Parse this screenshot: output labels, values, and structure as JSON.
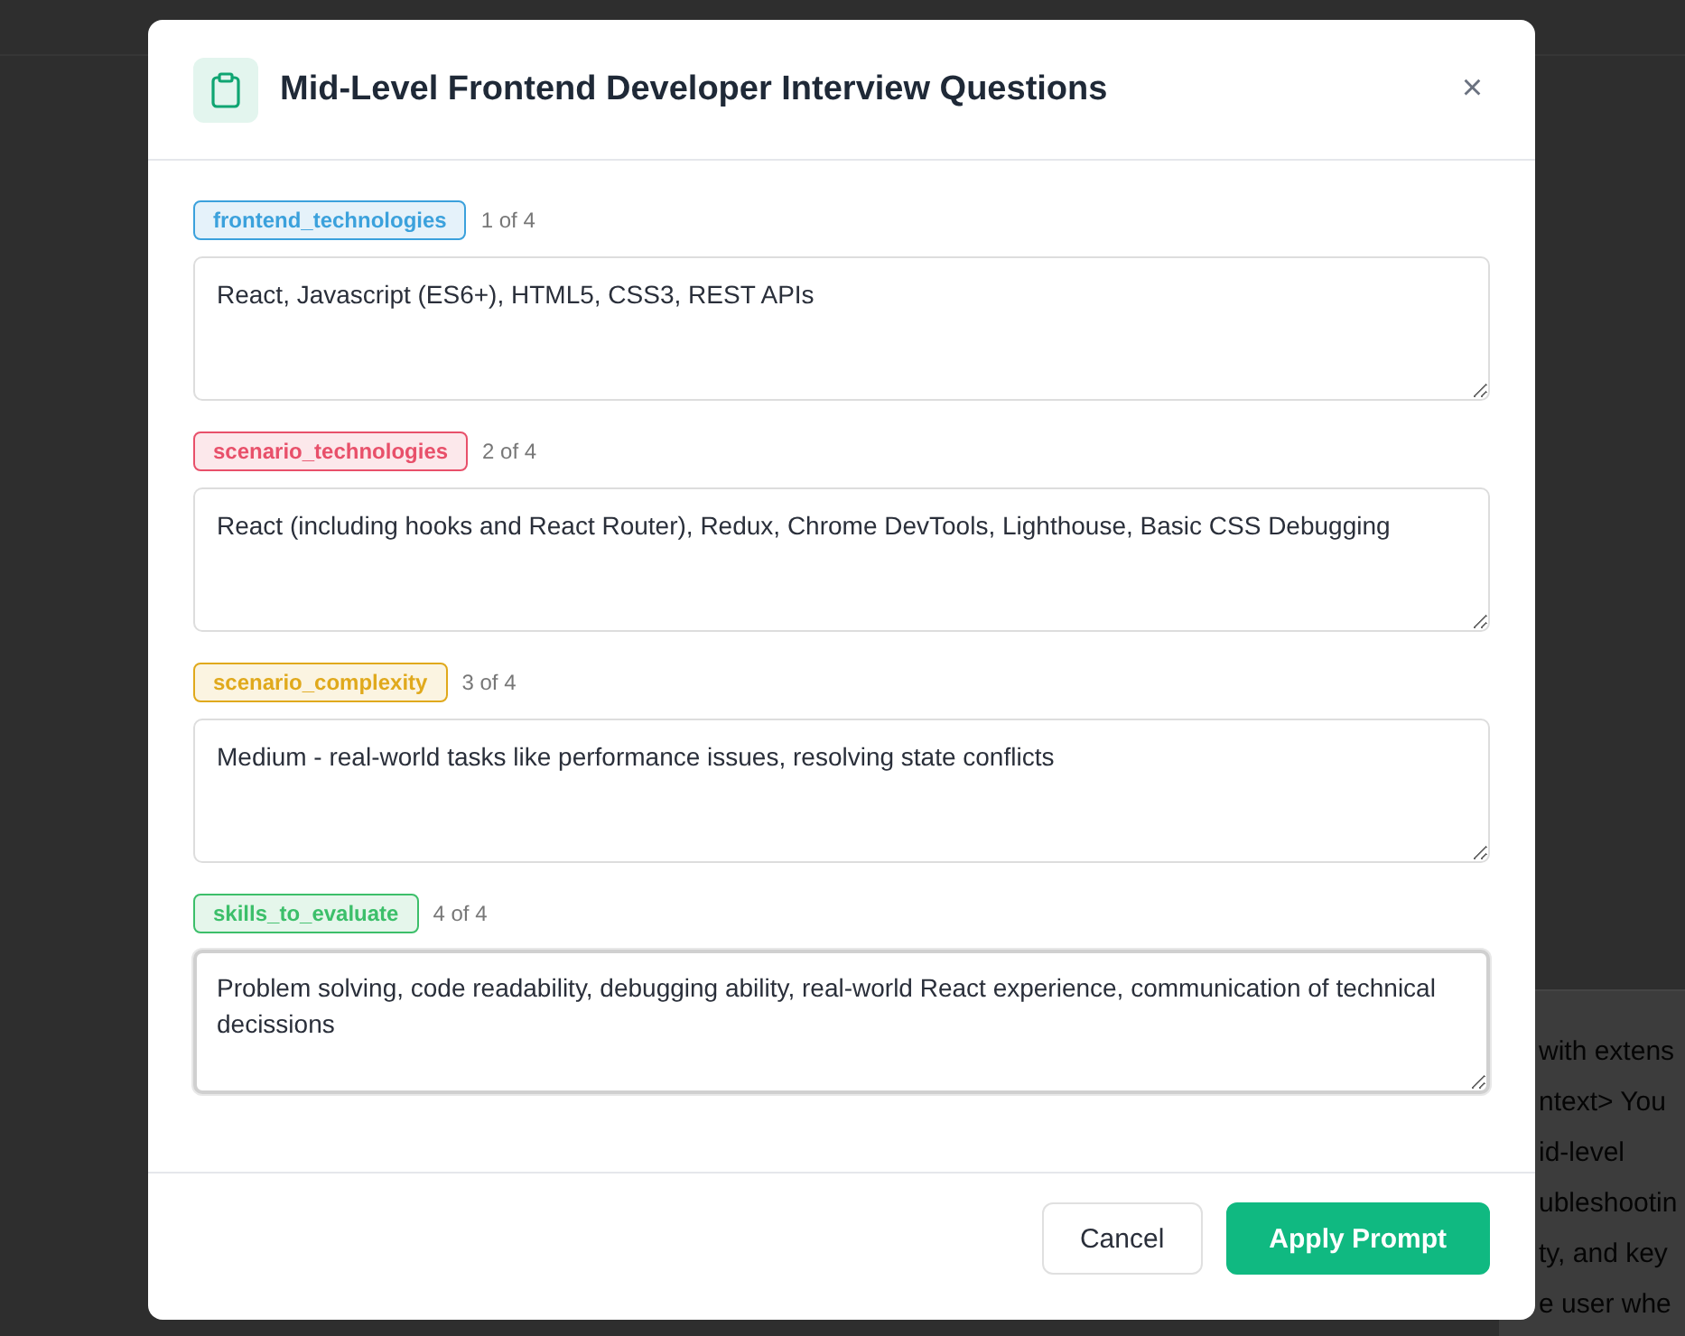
{
  "background_lines": [
    "with extens",
    "ntext> You",
    "id-level",
    "ubleshootin",
    "ty, and key",
    "e user whe"
  ],
  "dialog": {
    "title": "Mid-Level Frontend Developer Interview Questions",
    "close": "×",
    "fields": [
      {
        "tag": "frontend_technologies",
        "color": "#3ba1dc",
        "count": "1 of 4",
        "value": "React, Javascript (ES6+), HTML5, CSS3, REST APIs",
        "focused": false
      },
      {
        "tag": "scenario_technologies",
        "color": "#e8506a",
        "count": "2 of 4",
        "value": "React (including hooks and React Router), Redux, Chrome DevTools, Lighthouse, Basic CSS Debugging",
        "focused": false
      },
      {
        "tag": "scenario_complexity",
        "color": "#e0a91c",
        "count": "3 of 4",
        "value": "Medium - real-world tasks like performance issues, resolving state conflicts",
        "focused": false
      },
      {
        "tag": "skills_to_evaluate",
        "color": "#3cbf6a",
        "count": "4 of 4",
        "value": "Problem solving, code readability, debugging ability, real-world React experience, communication of technical decissions",
        "focused": true
      }
    ],
    "buttons": [
      {
        "label": "Cancel",
        "kind": "secondary"
      },
      {
        "label": "Apply Prompt",
        "kind": "primary"
      }
    ]
  }
}
